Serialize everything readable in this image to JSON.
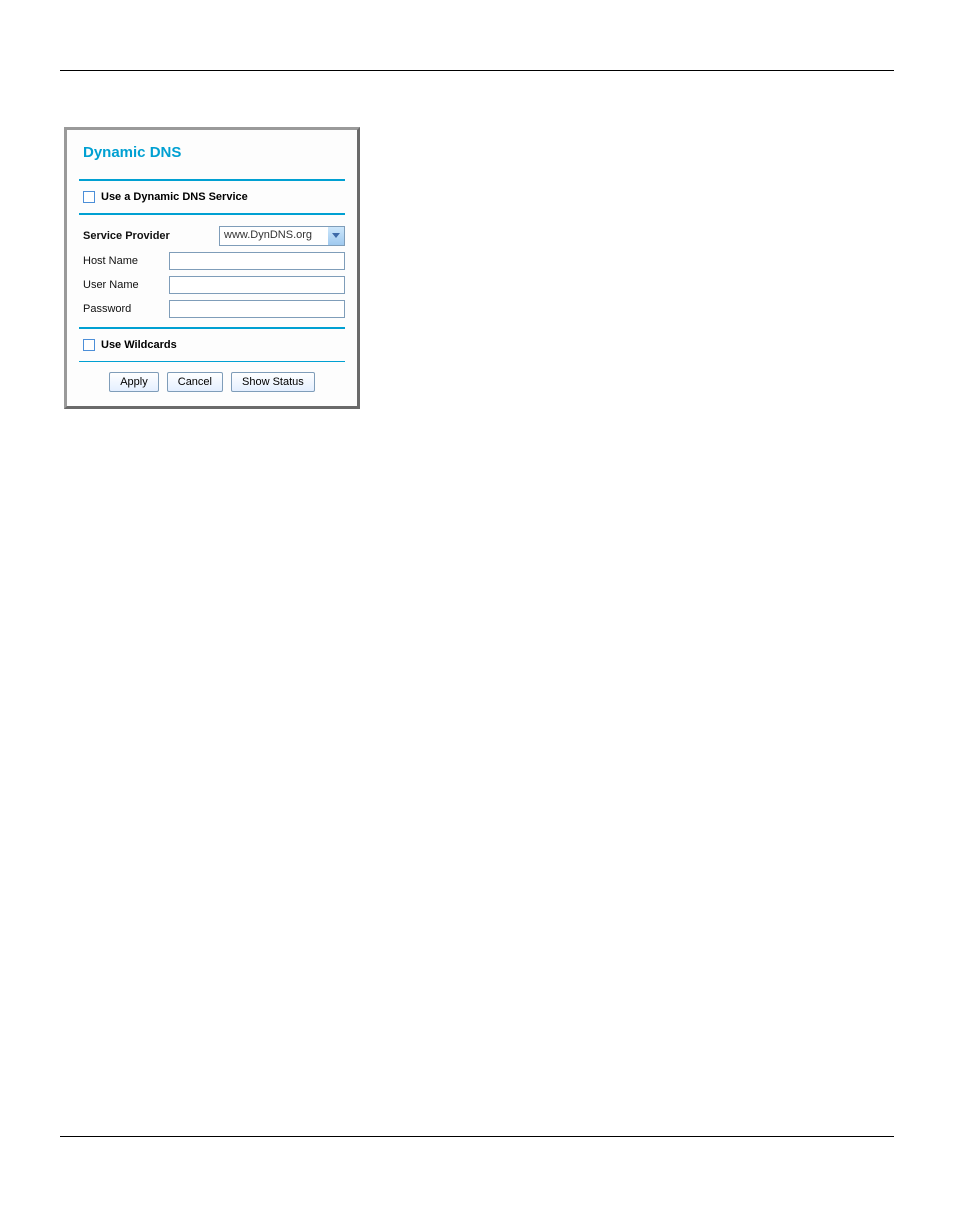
{
  "panel": {
    "title": "Dynamic DNS",
    "useService": {
      "label": "Use a Dynamic DNS Service",
      "checked": false
    },
    "provider": {
      "label": "Service Provider",
      "value": "www.DynDNS.org"
    },
    "hostName": {
      "label": "Host Name",
      "value": ""
    },
    "userName": {
      "label": "User Name",
      "value": ""
    },
    "password": {
      "label": "Password",
      "value": ""
    },
    "useWildcards": {
      "label": "Use Wildcards",
      "checked": false
    },
    "buttons": {
      "apply": "Apply",
      "cancel": "Cancel",
      "showStatus": "Show Status"
    }
  }
}
